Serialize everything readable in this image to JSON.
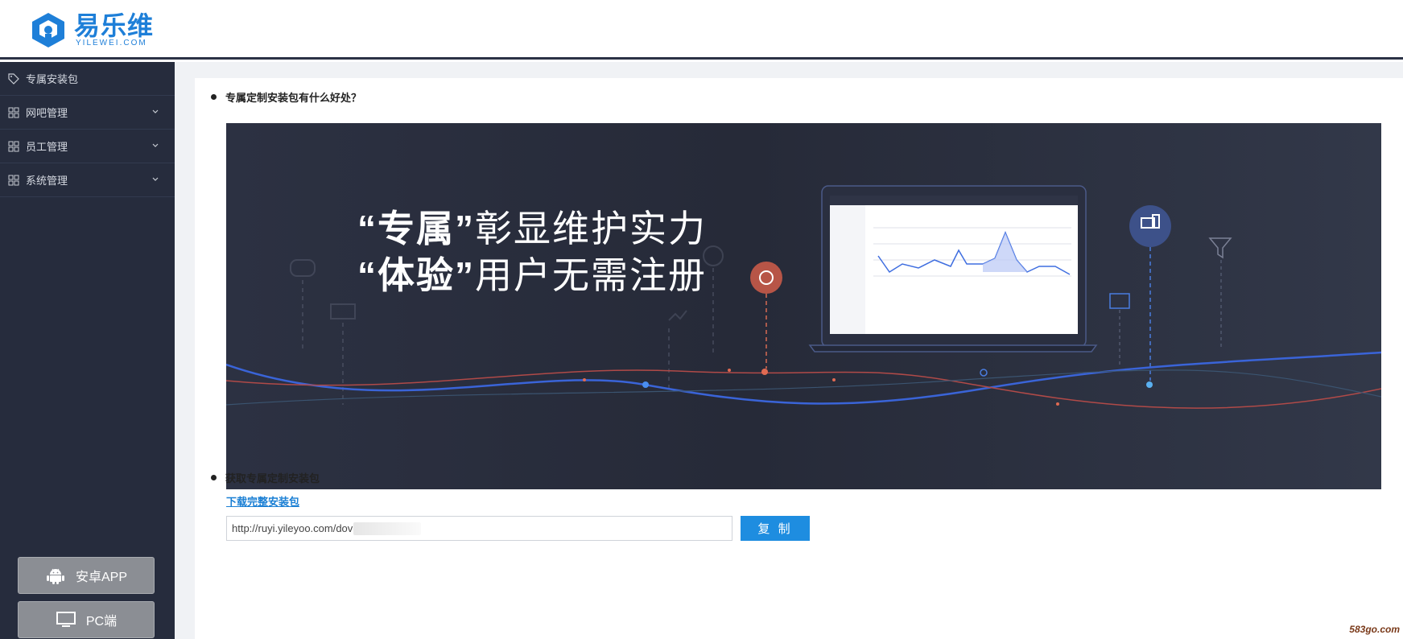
{
  "brand": {
    "name_cn": "易乐维",
    "name_en": "YILEWEI.COM",
    "color": "#1e7fd8"
  },
  "sidebar": {
    "items": [
      {
        "label": "专属安装包",
        "icon": "tag-icon",
        "expandable": false
      },
      {
        "label": "网吧管理",
        "icon": "grid-icon",
        "expandable": true
      },
      {
        "label": "员工管理",
        "icon": "grid-icon",
        "expandable": true
      },
      {
        "label": "系统管理",
        "icon": "grid-icon",
        "expandable": true
      }
    ],
    "buttons": [
      {
        "label": "安卓APP",
        "icon": "android-icon"
      },
      {
        "label": "PC端",
        "icon": "monitor-icon"
      }
    ],
    "background": "#262c3d"
  },
  "main": {
    "section1_title": "专属定制安装包有什么好处？",
    "banner": {
      "line1_strong": "“专属”",
      "line1_rest": "彰显维护实力",
      "line2_strong": "“体验”",
      "line2_rest": "用户无需注册"
    },
    "section2_title": "获取专属定制安装包",
    "download_link": "下载完整安装包",
    "url_value": "http://ruyi.yileyoo.com/dov",
    "copy_label": "复 制",
    "accent": "#1e8de0"
  },
  "watermark": "583go.com"
}
